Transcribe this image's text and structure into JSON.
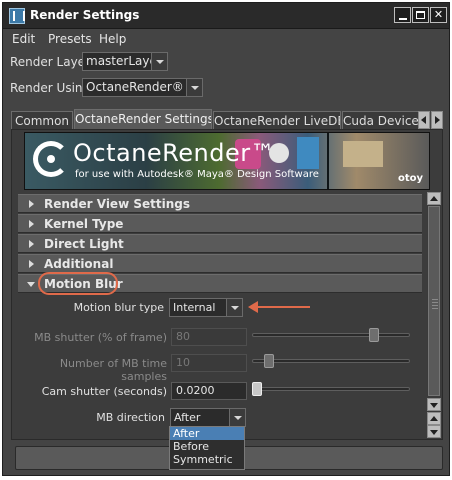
{
  "window": {
    "title": "Render Settings"
  },
  "menu": {
    "items": [
      "Edit",
      "Presets",
      "Help"
    ]
  },
  "render_layer": {
    "label": "Render Layer",
    "value": "masterLayer"
  },
  "render_using": {
    "label": "Render Using",
    "value": "OctaneRender®"
  },
  "tabs": [
    {
      "label": "Common"
    },
    {
      "label": "OctaneRender Settings",
      "active": true
    },
    {
      "label": "OctaneRender LiveDB"
    },
    {
      "label": "Cuda Devices"
    }
  ],
  "banner": {
    "title": "OctaneRender™",
    "subtitle": "for use with Autodesk® Maya® Design Software",
    "brand": "otoy"
  },
  "sections": [
    {
      "label": "Render View Settings",
      "expanded": false
    },
    {
      "label": "Kernel Type",
      "expanded": false
    },
    {
      "label": "Direct Light",
      "expanded": false
    },
    {
      "label": "Additional",
      "expanded": false
    },
    {
      "label": "Motion Blur",
      "expanded": true
    }
  ],
  "motion_blur": {
    "type": {
      "label": "Motion blur type",
      "value": "Internal"
    },
    "mb_shutter": {
      "label": "MB shutter (% of frame)",
      "value": "80",
      "enabled": false,
      "slider_fraction": 0.8
    },
    "time_samples": {
      "label": "Number of MB time samples",
      "value": "10",
      "enabled": false,
      "slider_fraction": 0.1
    },
    "cam_shutter": {
      "label": "Cam shutter (seconds)",
      "value": "0.0200",
      "enabled": true,
      "slider_fraction": 0.0
    },
    "direction": {
      "label": "MB direction",
      "value": "After",
      "options": [
        "After",
        "Before",
        "Symmetric"
      ],
      "selected": "After"
    }
  },
  "colors": {
    "highlight": "#e06a4a",
    "selection": "#4a7fb4"
  }
}
